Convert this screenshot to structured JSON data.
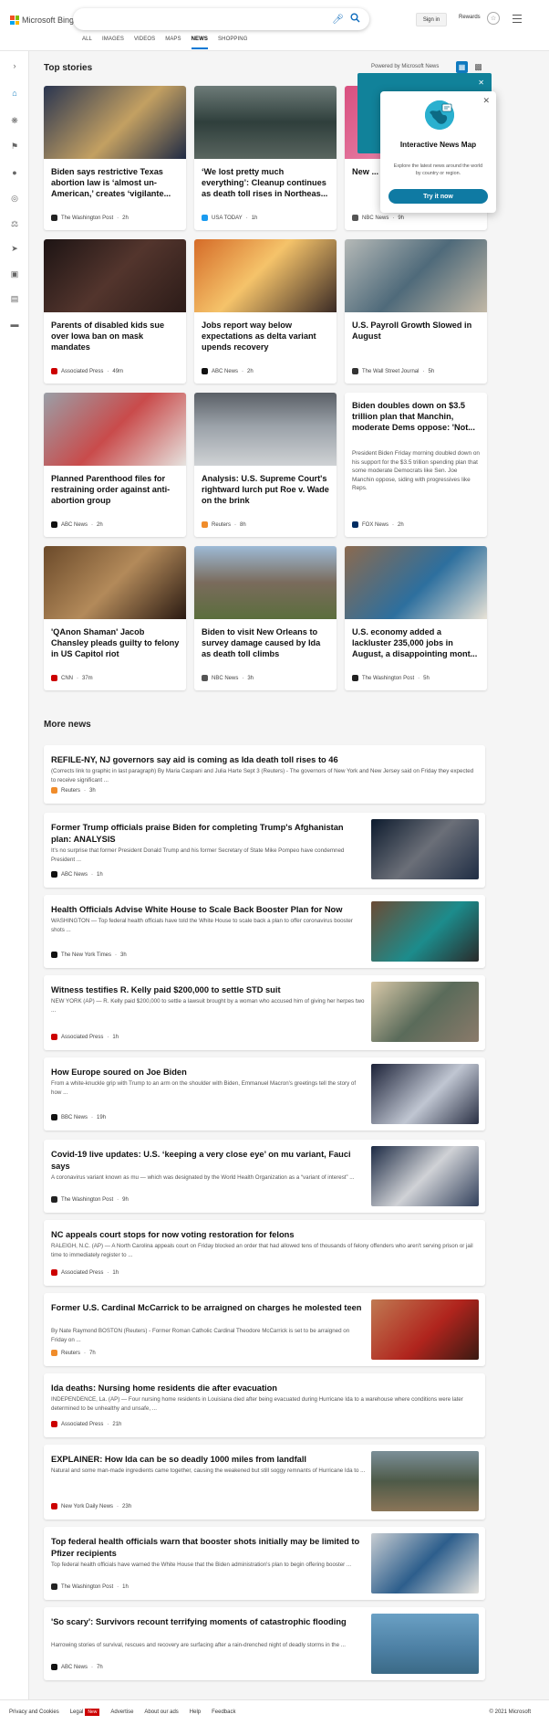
{
  "header": {
    "brand": "Microsoft Bing",
    "search_value": "",
    "sign_in": "Sign in",
    "rewards": "Rewards"
  },
  "nav": [
    "ALL",
    "IMAGES",
    "VIDEOS",
    "MAPS",
    "NEWS",
    "SHOPPING"
  ],
  "nav_selected": "NEWS",
  "sidebar_icons": [
    "collapse-icon",
    "home-icon",
    "coronavirus-icon",
    "flag-icon",
    "location-icon",
    "globe-icon",
    "scale-icon",
    "rocket-icon",
    "monitor-icon",
    "building-icon",
    "money-icon"
  ],
  "top_stories": {
    "heading": "Top stories",
    "powered_by": "Powered by Microsoft News",
    "cards": [
      {
        "title": "Biden says restrictive Texas abortion law is ‘almost un-American,’ creates ‘vigilante...",
        "source": "The Washington Post",
        "time": "2h"
      },
      {
        "title": "‘We lost pretty much everything’: Cleanup continues as death toll rises in Northeas...",
        "source": "USA TODAY",
        "time": "1h"
      },
      {
        "title": "New ... after ... Texa...",
        "source": "NBC News",
        "time": "9h"
      },
      {
        "title": "Parents of disabled kids sue over Iowa ban on mask mandates",
        "source": "Associated Press",
        "time": "49m"
      },
      {
        "title": "Jobs report way below expectations as delta variant upends recovery",
        "source": "ABC News",
        "time": "2h"
      },
      {
        "title": "U.S. Payroll Growth Slowed in August",
        "source": "The Wall Street Journal",
        "time": "5h"
      },
      {
        "title": "Planned Parenthood files for restraining order against anti-abortion group",
        "source": "ABC News",
        "time": "2h"
      },
      {
        "title": "Analysis: U.S. Supreme Court's rightward lurch put Roe v. Wade on the brink",
        "source": "Reuters",
        "time": "8h"
      },
      {
        "title": "Biden doubles down on $3.5 trillion plan that Manchin, moderate Dems oppose: 'Not...",
        "desc": "President Biden Friday morning doubled down on his support for the $3.5 trillion spending plan that some moderate Democrats like Sen. Joe Manchin oppose, siding with progressives like Reps.",
        "source": "FOX News",
        "time": "2h"
      },
      {
        "title": "'QAnon Shaman' Jacob Chansley pleads guilty to felony in US Capitol riot",
        "source": "CNN",
        "time": "37m"
      },
      {
        "title": "Biden to visit New Orleans to survey damage caused by Ida as death toll climbs",
        "source": "NBC News",
        "time": "3h"
      },
      {
        "title": "U.S. economy added a lackluster 235,000 jobs in August, a disappointing mont...",
        "source": "The Washington Post",
        "time": "5h"
      }
    ]
  },
  "popup": {
    "title": "Interactive News Map",
    "text": "Explore the latest news around the world by country or region.",
    "button": "Try it now"
  },
  "more_news": {
    "heading": "More news",
    "items": [
      {
        "title": "REFILE-NY, NJ governors say aid is coming as Ida death toll rises to 46",
        "desc": "(Corrects link to graphic in last paragraph) By Maria Caspani and Julia Harte Sept 3 (Reuters) - The governors of New York and New Jersey said on Friday they expected to receive significant ...",
        "source": "Reuters",
        "time": "3h"
      },
      {
        "title": "Former Trump officials praise Biden for completing Trump's Afghanistan plan: ANALYSIS",
        "desc": "It's no surprise that former President Donald Trump and his former Secretary of State Mike Pompeo have condemned President ...",
        "source": "ABC News",
        "time": "1h"
      },
      {
        "title": "Health Officials Advise White House to Scale Back Booster Plan for Now",
        "desc": "WASHINGTON — Top federal health officials have told the White House to scale back a plan to offer coronavirus booster shots ...",
        "source": "The New York Times",
        "time": "3h"
      },
      {
        "title": "Witness testifies R. Kelly paid $200,000 to settle STD suit",
        "desc": "NEW YORK (AP) — R. Kelly paid $200,000 to settle a lawsuit brought by a woman who accused him of giving her herpes two ...",
        "source": "Associated Press",
        "time": "1h"
      },
      {
        "title": "How Europe soured on Joe Biden",
        "desc": "From a white-knuckle grip with Trump to an arm on the shoulder with Biden, Emmanuel Macron's greetings tell the story of how ...",
        "source": "BBC News",
        "time": "19h"
      },
      {
        "title": "Covid-19 live updates: U.S. ‘keeping a very close eye’ on mu variant, Fauci says",
        "desc": "A coronavirus variant known as mu — which was designated by the World Health Organization as a “variant of interest” ...",
        "source": "The Washington Post",
        "time": "9h"
      },
      {
        "title": "NC appeals court stops for now voting restoration for felons",
        "desc": "RALEIGH, N.C. (AP) — A North Carolina appeals court on Friday blocked an order that had allowed tens of thousands of felony offenders who aren't serving prison or jail time to immediately register to ...",
        "source": "Associated Press",
        "time": "1h"
      },
      {
        "title": "Former U.S. Cardinal McCarrick to be arraigned on charges he molested teen",
        "desc": "By Nate Raymond BOSTON (Reuters) - Former Roman Catholic Cardinal Theodore McCarrick is set to be arraigned on Friday on ...",
        "source": "Reuters",
        "time": "7h"
      },
      {
        "title": "Ida deaths: Nursing home residents die after evacuation",
        "desc": "INDEPENDENCE, La. (AP) — Four nursing home residents in Louisiana died after being evacuated during Hurricane Ida to a warehouse where conditions were later determined to be unhealthy and unsafe, ...",
        "source": "Associated Press",
        "time": "21h"
      },
      {
        "title": "EXPLAINER: How Ida can be so deadly 1000 miles from landfall",
        "desc": "Natural and some man-made ingredients came together, causing the weakened but still soggy remnants of Hurricane Ida to ...",
        "source": "New York Daily News",
        "time": "23h"
      },
      {
        "title": "Top federal health officials warn that booster shots initially may be limited to Pfizer recipients",
        "desc": "Top federal health officials have warned the White House that the Biden administration's plan to begin offering booster ...",
        "source": "The Washington Post",
        "time": "1h"
      },
      {
        "title": "'So scary': Survivors recount terrifying moments of catastrophic flooding",
        "desc": "Harrowing stories of survival, rescues and recovery are surfacing after a rain-drenched night of deadly storms in the ...",
        "source": "ABC News",
        "time": "7h"
      }
    ]
  },
  "footer": {
    "links": [
      "Privacy and Cookies",
      "Legal",
      "Advertise",
      "About our ads",
      "Help",
      "Feedback"
    ],
    "new_badge": "New",
    "copyright": "© 2021 Microsoft"
  }
}
